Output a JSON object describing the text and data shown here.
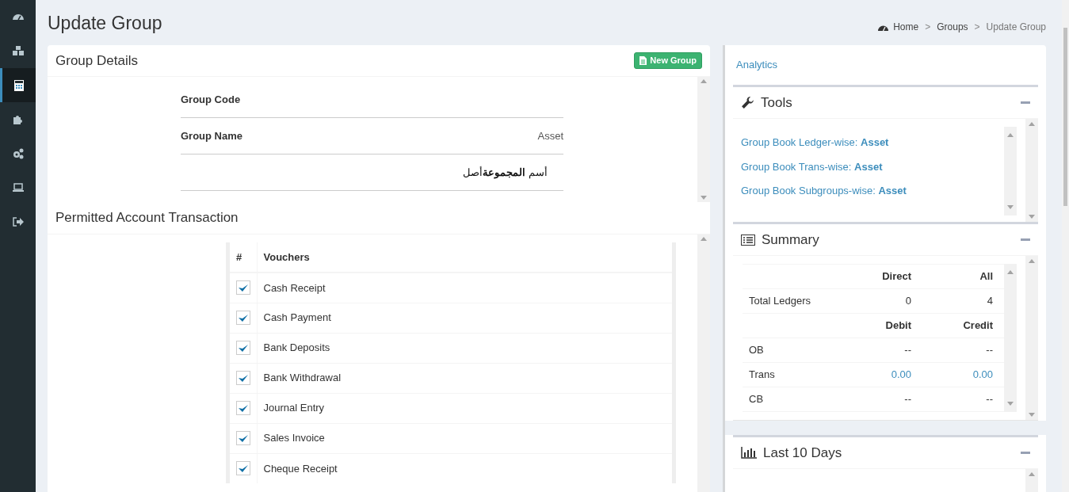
{
  "sidebar": {
    "items": [
      {
        "kind": "gauge",
        "selected": false
      },
      {
        "kind": "cubes",
        "selected": false
      },
      {
        "kind": "calculator",
        "selected": true
      },
      {
        "kind": "puzzle",
        "selected": false
      },
      {
        "kind": "gears",
        "selected": false
      },
      {
        "kind": "laptop",
        "selected": false
      },
      {
        "kind": "signout",
        "selected": false
      }
    ]
  },
  "page_title": "Update Group",
  "breadcrumb": [
    {
      "label": "Home",
      "kind": "home",
      "current": false
    },
    {
      "label": "Groups",
      "kind": "link",
      "current": false,
      "separator": ">"
    },
    {
      "label": "Update Group",
      "kind": "link",
      "current": true,
      "separator": ">"
    }
  ],
  "group_details": {
    "title": "Group Details",
    "new_button": "New Group",
    "fields": [
      {
        "label": "Group Code"
      },
      {
        "label": "Group Name",
        "value": "Asset"
      },
      {
        "value": "أسم **المجموعة**أصل"
      }
    ]
  },
  "permitted": {
    "title": "Permitted Account Transaction",
    "columns": [
      "#",
      "Vouchers"
    ],
    "rows": [
      {
        "label": "Cash Receipt",
        "checked": true
      },
      {
        "label": "Cash Payment",
        "checked": true
      },
      {
        "label": "Bank Deposits",
        "checked": true
      },
      {
        "label": "Bank Withdrawal",
        "checked": true
      },
      {
        "label": "Journal Entry",
        "checked": true
      },
      {
        "label": "Sales Invoice",
        "checked": true
      },
      {
        "label": "Cheque Receipt",
        "checked": true
      }
    ]
  },
  "analytics_link": "Analytics",
  "tools": {
    "title": "Tools",
    "links": [
      "Group Book Ledger-wise: **Asset**",
      "Group Book Trans-wise: **Asset**",
      "Group Book Subgroups-wise: **Asset**"
    ]
  },
  "summary": {
    "title": "Summary",
    "rows": [
      {
        "kind": "head",
        "columns": [
          "Direct",
          "All"
        ]
      },
      {
        "kind": "row",
        "label": "Total Ledgers",
        "values": [
          "0",
          "4"
        ]
      },
      {
        "kind": "head",
        "columns": [
          "Debit",
          "Credit"
        ]
      },
      {
        "kind": "row",
        "label": "OB",
        "values": [
          "--",
          "--"
        ]
      },
      {
        "kind": "link-row",
        "label": "Trans",
        "values": [
          "0.00",
          "0.00"
        ]
      },
      {
        "kind": "row",
        "label": "CB",
        "values": [
          "--",
          "--"
        ]
      }
    ]
  },
  "last_days": {
    "title": "Last 10 Days"
  }
}
